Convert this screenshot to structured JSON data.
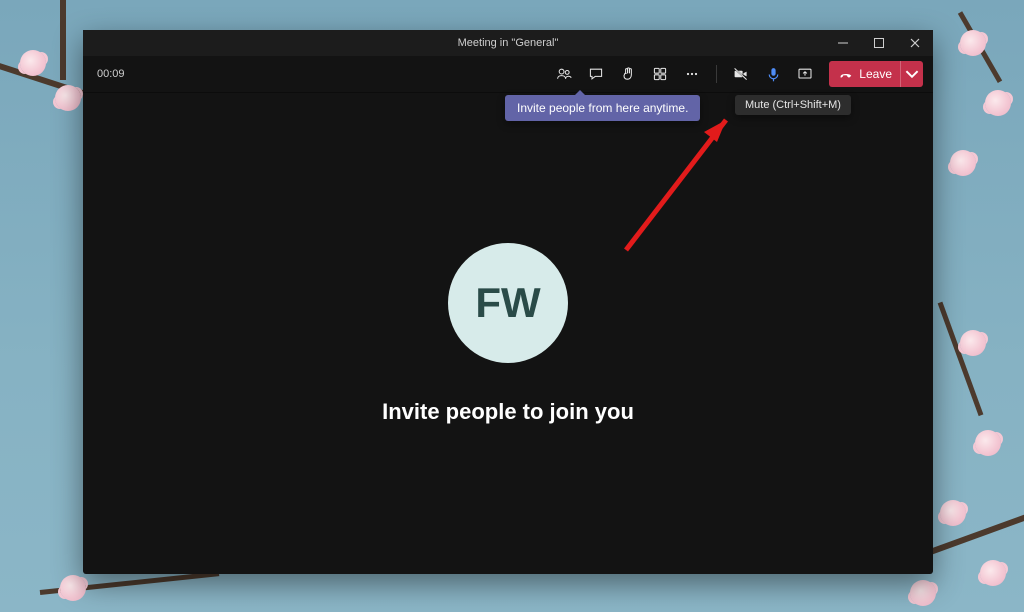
{
  "title": "Meeting in \"General\"",
  "timer": "00:09",
  "invite_tip": "Invite people from here anytime.",
  "mute_tip": "Mute (Ctrl+Shift+M)",
  "avatar_initials": "FW",
  "invite_headline": "Invite people to join you",
  "leave_label": "Leave",
  "avatar_bg": "#d7ebea",
  "accent_leave": "#c4314b",
  "accent_tip": "#6264a7"
}
